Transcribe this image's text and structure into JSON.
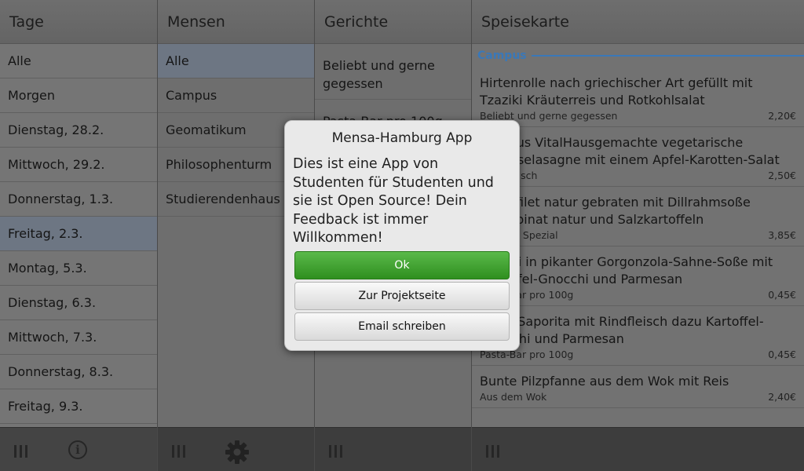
{
  "columns": {
    "days": {
      "header": "Tage",
      "items": [
        "Alle",
        "Morgen",
        "Dienstag, 28.2.",
        "Mittwoch, 29.2.",
        "Donnerstag, 1.3.",
        "Freitag, 2.3.",
        "Montag, 5.3.",
        "Dienstag, 6.3.",
        "Mittwoch, 7.3.",
        "Donnerstag, 8.3.",
        "Freitag, 9.3."
      ]
    },
    "cafeterias": {
      "header": "Mensen",
      "items": [
        "Alle",
        "Campus",
        "Geomatikum",
        "Philosophenturm",
        "Studierendenhaus"
      ]
    },
    "dishes": {
      "header": "Gerichte",
      "items": [
        "Beliebt und gerne gegessen",
        "Pasta-Bar pro 100g"
      ]
    },
    "menu": {
      "header": "Speisekarte",
      "section": "Campus",
      "items": [
        {
          "title": "Hirtenrolle nach griechischer Art gefüllt mit Tzaziki Kräuterreis und Rotkohlsalat",
          "category": "Beliebt und gerne gegessen",
          "price": "2,20€"
        },
        {
          "title": "Campus VitalHausgemachte vegetarische Gemüselasagne mit einem Apfel-Karotten-Salat",
          "category": "Vegetarisch",
          "price": "2,50€"
        },
        {
          "title": "Lachsfilet natur gebraten mit Dillrahmsoße Blattspinat natur und Salzkartoffeln",
          "category": "Campus Spezial",
          "price": "3,85€"
        },
        {
          "title": "Ravioli in pikanter Gorgonzola-Sahne-Soße mit Kartoffel-Gnocchi und Parmesan",
          "category": "Pasta-Bar pro 100g",
          "price": "0,45€"
        },
        {
          "title": "Pasta Saporita mit Rindfleisch dazu Kartoffel-Gnocchi und Parmesan",
          "category": "Pasta-Bar pro 100g",
          "price": "0,45€"
        },
        {
          "title": "Bunte Pilzpfanne aus dem Wok mit Reis",
          "category": "Aus dem Wok",
          "price": "2,40€"
        }
      ]
    }
  },
  "dialog": {
    "title": "Mensa-Hamburg App",
    "message": "Dies ist eine App von Studenten für Studenten und sie ist Open Source! Dein Feedback ist immer Willkommen!",
    "ok_label": "Ok",
    "project_label": "Zur Projektseite",
    "email_label": "Email schreiben"
  },
  "icons": {
    "menu": "bars-icon",
    "info": "info-icon",
    "settings": "gear-icon"
  },
  "colors": {
    "accent": "#3a78b8",
    "ok_button": "#3a9a28"
  }
}
